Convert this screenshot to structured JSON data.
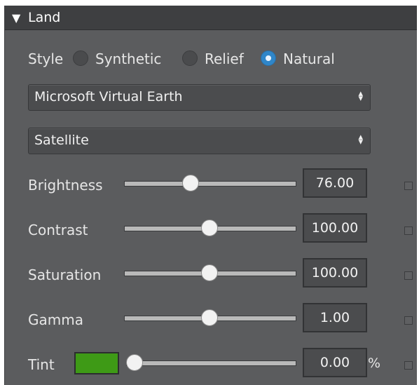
{
  "panel": {
    "title": "Land",
    "style_label": "Style",
    "style_options": [
      {
        "label": "Synthetic",
        "selected": false
      },
      {
        "label": "Relief",
        "selected": false
      },
      {
        "label": "Natural",
        "selected": true
      }
    ],
    "provider_select": "Microsoft Virtual Earth",
    "imagery_select": "Satellite",
    "sliders": [
      {
        "label": "Brightness",
        "value": "76.00"
      },
      {
        "label": "Contrast",
        "value": "100.00"
      },
      {
        "label": "Saturation",
        "value": "100.00"
      },
      {
        "label": "Gamma",
        "value": "1.00"
      },
      {
        "label": "Tint",
        "value": "0.00",
        "unit": "%"
      }
    ],
    "tint_color": "#3e9a16",
    "accent_color": "#2f86c9"
  },
  "icons": {
    "collapse": "triangle-down-icon",
    "select_arrows": "up-down-arrows-icon"
  }
}
